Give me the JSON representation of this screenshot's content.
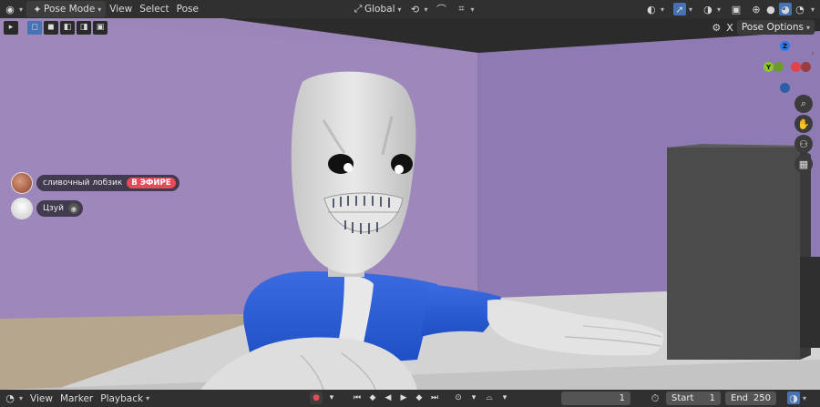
{
  "header": {
    "mode": "Pose Mode",
    "menus": [
      "View",
      "Select",
      "Pose"
    ],
    "orientation": "Global"
  },
  "viewport": {
    "pose_options": "Pose Options",
    "x_label": "X",
    "gizmo": {
      "z": "Z",
      "y": "Y"
    }
  },
  "overlay": {
    "user1_name": "сливочный лобзик",
    "user1_badge": "В ЭФИРЕ",
    "user2_name": "Цзуй"
  },
  "timeline": {
    "menus": [
      "View",
      "Marker",
      "Playback"
    ],
    "current_frame": "1",
    "start_label": "Start",
    "start_value": "1",
    "end_label": "End",
    "end_value": "250"
  },
  "colors": {
    "wall": "#9a84b8",
    "floor": "#c9c9c9",
    "shirt": "#2f62d8",
    "accent": "#4772b3"
  }
}
